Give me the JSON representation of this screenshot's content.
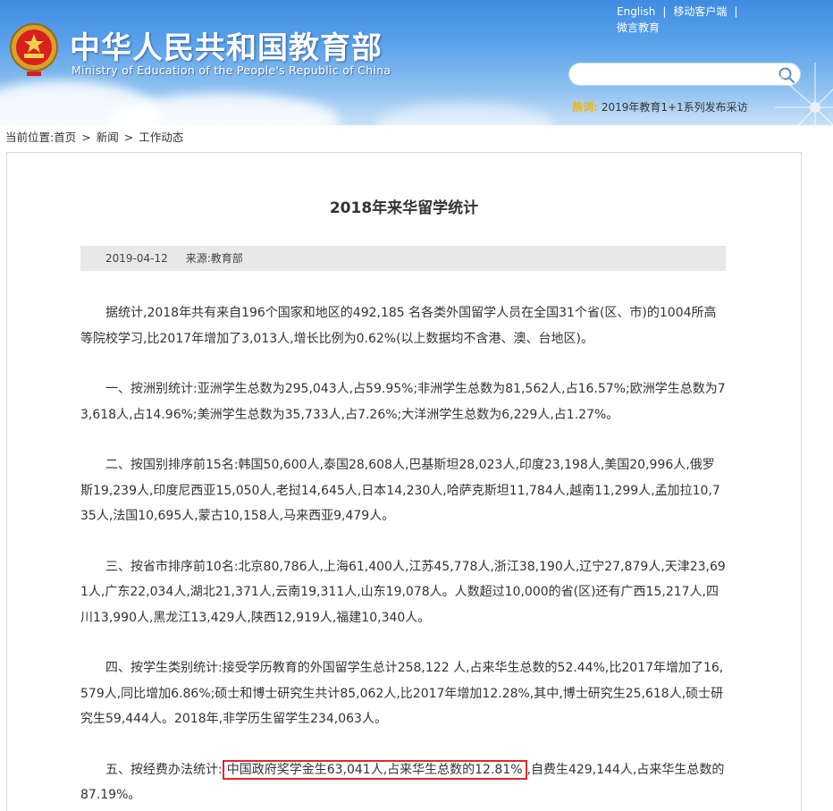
{
  "header": {
    "title": "中华人民共和国教育部",
    "subtitle": "Ministry of Education of the People's Republic of China",
    "links": [
      "English",
      "移动客户端",
      "微言教育"
    ],
    "separator": "|",
    "search_placeholder": "",
    "hot_label": "热词:",
    "hot_text": "2019年教育1+1系列发布采访"
  },
  "breadcrumb": {
    "prefix": "当前位置:",
    "items": [
      "首页",
      "新闻",
      "工作动态"
    ],
    "arrow": ">"
  },
  "article": {
    "title": "2018年来华留学统计",
    "date": "2019-04-12",
    "source": "来源:教育部",
    "paragraphs": [
      "据统计,2018年共有来自196个国家和地区的492,185 名各类外国留学人员在全国31个省(区、市)的1004所高等院校学习,比2017年增加了3,013人,增长比例为0.62%(以上数据均不含港、澳、台地区)。",
      "一、按洲别统计:亚洲学生总数为295,043人,占59.95%;非洲学生总数为81,562人,占16.57%;欧洲学生总数为73,618人,占14.96%;美洲学生总数为35,733人,占7.26%;大洋洲学生总数为6,229人,占1.27%。",
      "二、按国别排序前15名:韩国50,600人,泰国28,608人,巴基斯坦28,023人,印度23,198人,美国20,996人,俄罗斯19,239人,印度尼西亚15,050人,老挝14,645人,日本14,230人,哈萨克斯坦11,784人,越南11,299人,孟加拉10,735人,法国10,695人,蒙古10,158人,马来西亚9,479人。",
      "三、按省市排序前10名:北京80,786人,上海61,400人,江苏45,778人,浙江38,190人,辽宁27,879人,天津23,691人,广东22,034人,湖北21,371人,云南19,311人,山东19,078人。人数超过10,000的省(区)还有广西15,217人,四川13,990人,黑龙江13,429人,陕西12,919人,福建10,340人。",
      "四、按学生类别统计:接受学历教育的外国留学生总计258,122 人,占来华生总数的52.44%,比2017年增加了16,579人,同比增加6.86%;硕士和博士研究生共计85,062人,比2017年增加12.28%,其中,博士研究生25,618人,硕士研究生59,444人。2018年,非学历生留学生234,063人。"
    ],
    "p5_before": "五、按经费办法统计:",
    "p5_highlight": "中国政府奖学金生63,041人,占来华生总数的12.81%",
    "p5_after": ",自费生429,144人,占来华生总数的87.19%。"
  },
  "colors": {
    "highlight_border": "#e0282c",
    "hot_label": "#f5b400",
    "header_sky": "#4a94e4"
  }
}
